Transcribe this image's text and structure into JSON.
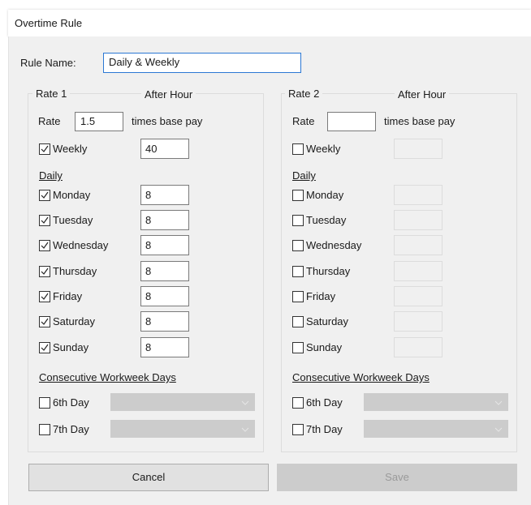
{
  "window": {
    "title": "Overtime Rule"
  },
  "rule_name": {
    "label": "Rule Name:",
    "value": "Daily & Weekly"
  },
  "rate1": {
    "group_label": "Rate 1",
    "after_hour_label": "After Hour",
    "rate_label": "Rate",
    "rate_value": "1.5",
    "times_base_pay_label": "times base pay",
    "weekly": {
      "label": "Weekly",
      "checked": true,
      "value": "40"
    },
    "daily_label": "Daily",
    "days": [
      {
        "label": "Monday",
        "checked": true,
        "value": "8"
      },
      {
        "label": "Tuesday",
        "checked": true,
        "value": "8"
      },
      {
        "label": "Wednesday",
        "checked": true,
        "value": "8"
      },
      {
        "label": "Thursday",
        "checked": true,
        "value": "8"
      },
      {
        "label": "Friday",
        "checked": true,
        "value": "8"
      },
      {
        "label": "Saturday",
        "checked": true,
        "value": "8"
      },
      {
        "label": "Sunday",
        "checked": true,
        "value": "8"
      }
    ],
    "consecutive_label": "Consecutive Workweek Days",
    "sixth_day": {
      "label": "6th Day",
      "checked": false
    },
    "seventh_day": {
      "label": "7th Day",
      "checked": false
    }
  },
  "rate2": {
    "group_label": "Rate 2",
    "after_hour_label": "After Hour",
    "rate_label": "Rate",
    "rate_value": "",
    "times_base_pay_label": "times base pay",
    "weekly": {
      "label": "Weekly",
      "checked": false,
      "value": ""
    },
    "daily_label": "Daily",
    "days": [
      {
        "label": "Monday",
        "checked": false,
        "value": ""
      },
      {
        "label": "Tuesday",
        "checked": false,
        "value": ""
      },
      {
        "label": "Wednesday",
        "checked": false,
        "value": ""
      },
      {
        "label": "Thursday",
        "checked": false,
        "value": ""
      },
      {
        "label": "Friday",
        "checked": false,
        "value": ""
      },
      {
        "label": "Saturday",
        "checked": false,
        "value": ""
      },
      {
        "label": "Sunday",
        "checked": false,
        "value": ""
      }
    ],
    "consecutive_label": "Consecutive Workweek Days",
    "sixth_day": {
      "label": "6th Day",
      "checked": false
    },
    "seventh_day": {
      "label": "7th Day",
      "checked": false
    }
  },
  "buttons": {
    "cancel_label": "Cancel",
    "save_label": "Save"
  },
  "colors": {
    "focus_border": "#2b78d4",
    "dialog_bg": "#f0f0f0",
    "disabled_fill": "#cccccc"
  }
}
